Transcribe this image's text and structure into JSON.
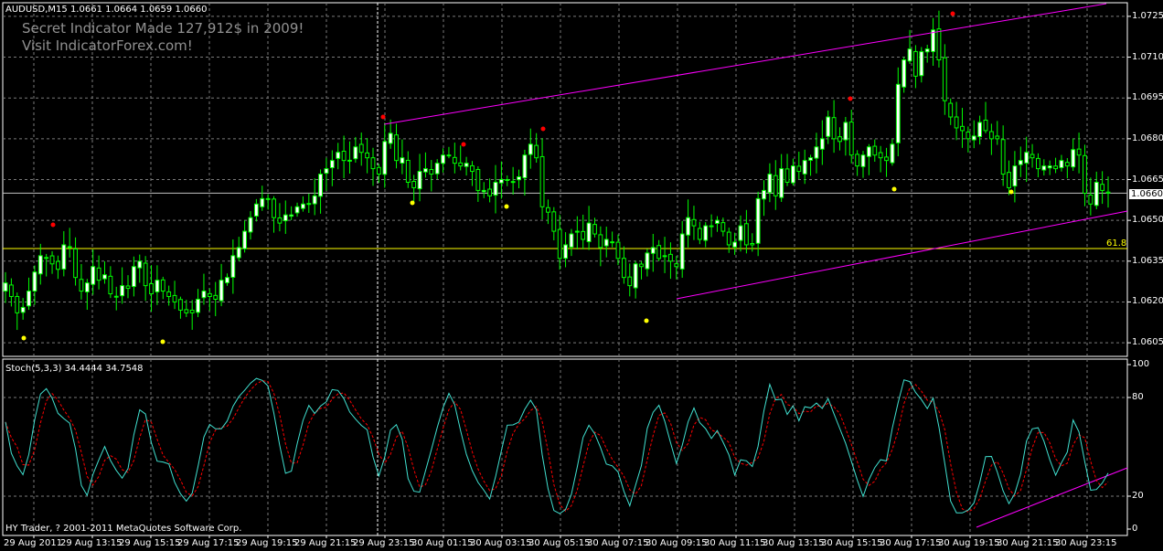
{
  "header": {
    "ohlc_line": "AUDUSD,M15  1.0661 1.0664 1.0659 1.0660",
    "promo_line1": "Secret Indicator Made 127,912$ in 2009!",
    "promo_line2": "Visit IndicatorForex.com!"
  },
  "indicator": {
    "label": "Stoch(5,3,3) 34.4444 34.7548",
    "copyright": "HY Trader, ? 2001-2011 MetaQuotes Software Corp."
  },
  "price_axis": {
    "ticks": [
      "1.0725",
      "1.0710",
      "1.0695",
      "1.0680",
      "1.0665",
      "1.0650",
      "1.0635",
      "1.0620",
      "1.0605"
    ],
    "current_price": "1.0660",
    "fib_label": "61.8"
  },
  "stoch_axis": {
    "ticks": [
      "100",
      "80",
      "20",
      "0"
    ]
  },
  "time_axis": {
    "labels": [
      "29 Aug 2011",
      "29 Aug 13:15",
      "29 Aug 15:15",
      "29 Aug 17:15",
      "29 Aug 19:15",
      "29 Aug 21:15",
      "29 Aug 23:15",
      "30 Aug 01:15",
      "30 Aug 03:15",
      "30 Aug 05:15",
      "30 Aug 07:15",
      "30 Aug 09:15",
      "30 Aug 11:15",
      "30 Aug 13:15",
      "30 Aug 15:15",
      "30 Aug 17:15",
      "30 Aug 19:15",
      "30 Aug 21:15",
      "30 Aug 23:15"
    ]
  },
  "colors": {
    "background": "#000000",
    "grid": "#7a7a7a",
    "candle": "#00ff00",
    "bull_body": "#ffffff",
    "bear_body": "#000000",
    "trendline": "#ff00ff",
    "fib_line": "#ffff00",
    "price_line": "#c0c0c0",
    "fractal_up": "#ff0000",
    "fractal_down": "#ffff00",
    "stoch_main": "#40e0d0",
    "stoch_signal": "#ff0000"
  },
  "chart_data": {
    "type": "candlestick",
    "symbol": "AUDUSD",
    "timeframe": "M15",
    "ylim": [
      1.06,
      1.073
    ],
    "closes": [
      1.0627,
      1.0622,
      1.0616,
      1.0618,
      1.0624,
      1.0631,
      1.0637,
      1.0636,
      1.0634,
      1.0632,
      1.0641,
      1.064,
      1.0629,
      1.0624,
      1.0627,
      1.0633,
      1.0628,
      1.063,
      1.0623,
      1.0622,
      1.0626,
      1.0625,
      1.0633,
      1.0635,
      1.0626,
      1.0623,
      1.0628,
      1.0624,
      1.0622,
      1.062,
      1.0617,
      1.0616,
      1.0616,
      1.0621,
      1.0624,
      1.0622,
      1.0621,
      1.0628,
      1.0629,
      1.0637,
      1.064,
      1.0646,
      1.0651,
      1.0656,
      1.0658,
      1.0658,
      1.0651,
      1.0649,
      1.0652,
      1.0652,
      1.0655,
      1.0656,
      1.0656,
      1.0659,
      1.0667,
      1.0669,
      1.0672,
      1.0675,
      1.0672,
      1.0672,
      1.0677,
      1.0675,
      1.0673,
      1.0669,
      1.0667,
      1.0679,
      1.0682,
      1.0672,
      1.0673,
      1.0664,
      1.0662,
      1.0668,
      1.0669,
      1.0667,
      1.0671,
      1.0674,
      1.0674,
      1.0671,
      1.067,
      1.0671,
      1.0668,
      1.0661,
      1.0661,
      1.0659,
      1.0664,
      1.0665,
      1.0665,
      1.0664,
      1.0666,
      1.0674,
      1.0678,
      1.0673,
      1.0655,
      1.0653,
      1.0646,
      1.0636,
      1.0641,
      1.0645,
      1.0646,
      1.0643,
      1.0649,
      1.0645,
      1.064,
      1.0643,
      1.0642,
      1.0636,
      1.0629,
      1.0626,
      1.0634,
      1.0633,
      1.0638,
      1.064,
      1.0636,
      1.0637,
      1.0635,
      1.0633,
      1.0645,
      1.0651,
      1.0648,
      1.0643,
      1.0648,
      1.0648,
      1.065,
      1.0646,
      1.0641,
      1.0642,
      1.0648,
      1.0641,
      1.0641,
      1.0658,
      1.0661,
      1.0667,
      1.0659,
      1.0669,
      1.0664,
      1.067,
      1.0668,
      1.0672,
      1.0673,
      1.0677,
      1.068,
      1.0688,
      1.068,
      1.0679,
      1.0686,
      1.0674,
      1.067,
      1.0674,
      1.0677,
      1.0674,
      1.0673,
      1.0672,
      1.0678,
      1.07,
      1.0709,
      1.0713,
      1.0703,
      1.0712,
      1.0713,
      1.072,
      1.0709,
      1.0694,
      1.0688,
      1.0684,
      1.0683,
      1.068,
      1.0681,
      1.0686,
      1.0683,
      1.068,
      1.068,
      1.0667,
      1.0662,
      1.067,
      1.0672,
      1.0675,
      1.0673,
      1.0669,
      1.067,
      1.067,
      1.0669,
      1.0672,
      1.067,
      1.0676,
      1.0674,
      1.066,
      1.0656,
      1.0664,
      1.0661,
      1.066
    ],
    "stoch_main_range": [
      0,
      100
    ]
  }
}
